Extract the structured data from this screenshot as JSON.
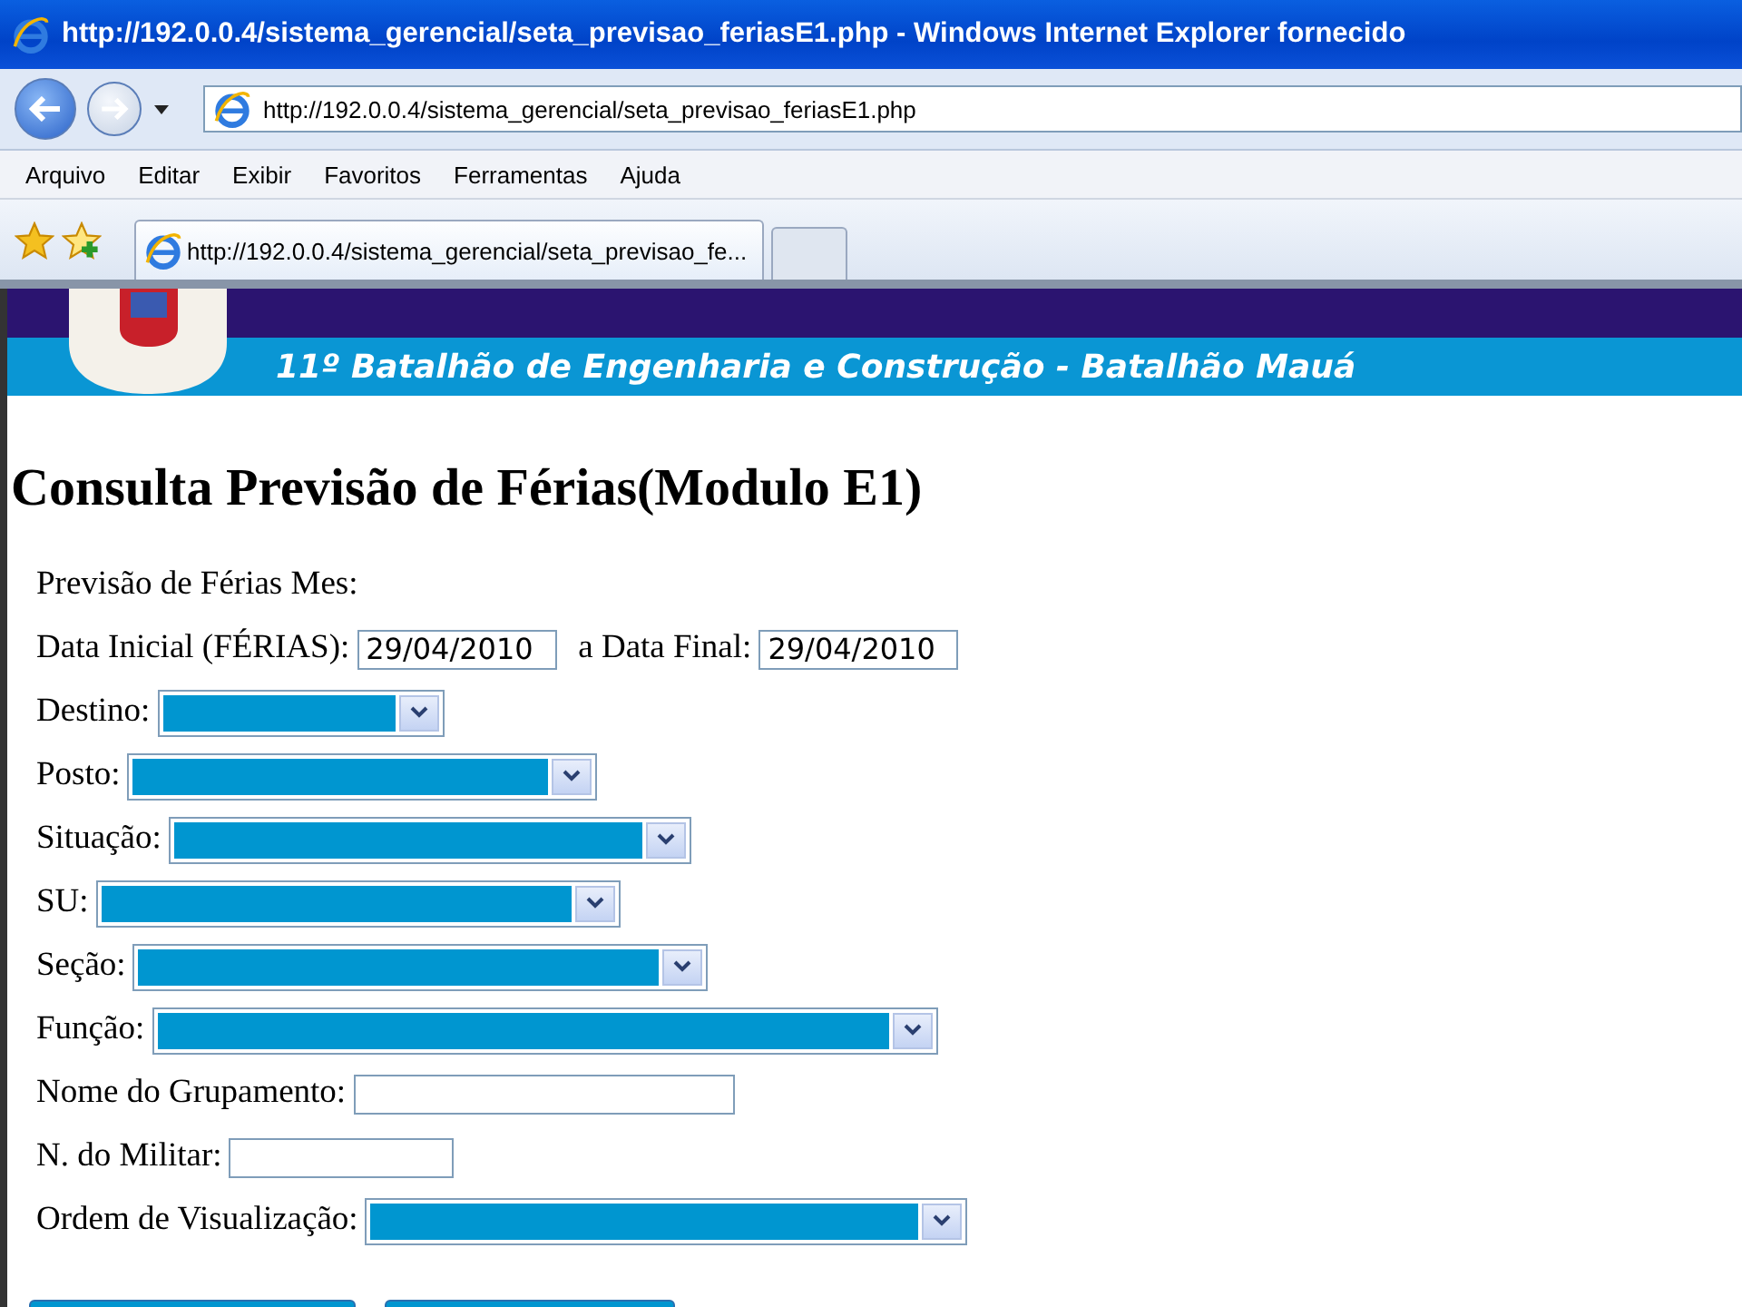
{
  "window": {
    "title": "http://192.0.0.4/sistema_gerencial/seta_previsao_feriasE1.php - Windows Internet Explorer fornecido"
  },
  "address_bar": {
    "url": "http://192.0.0.4/sistema_gerencial/seta_previsao_feriasE1.php"
  },
  "menu_bar": [
    "Arquivo",
    "Editar",
    "Exibir",
    "Favoritos",
    "Ferramentas",
    "Ajuda"
  ],
  "tabs": [
    {
      "label": "http://192.0.0.4/sistema_gerencial/seta_previsao_fe...",
      "selected": true
    }
  ],
  "banner": {
    "title": "11º Batalhão de Engenharia e Construção - Batalhão Mauá"
  },
  "heading": "Consulta Previsão de Férias(Modulo E1)",
  "form": [
    {
      "items": [
        {
          "kind": "label",
          "text": "Previsão de Férias Mes:"
        }
      ]
    },
    {
      "items": [
        {
          "kind": "label",
          "text": "Data Inicial (FÉRIAS):"
        },
        {
          "kind": "input",
          "value": "29/04/2010"
        },
        {
          "kind": "label",
          "text": "a Data Final:"
        },
        {
          "kind": "input",
          "value": "29/04/2010"
        }
      ]
    },
    {
      "items": [
        {
          "kind": "label",
          "text": "Destino:"
        },
        {
          "kind": "select"
        }
      ]
    },
    {
      "items": [
        {
          "kind": "label",
          "text": "Posto:"
        },
        {
          "kind": "select"
        }
      ]
    },
    {
      "items": [
        {
          "kind": "label",
          "text": "Situação:"
        },
        {
          "kind": "select"
        }
      ]
    },
    {
      "items": [
        {
          "kind": "label",
          "text": "SU:"
        },
        {
          "kind": "select"
        }
      ]
    },
    {
      "items": [
        {
          "kind": "label",
          "text": "Seção:"
        },
        {
          "kind": "select"
        }
      ]
    },
    {
      "items": [
        {
          "kind": "label",
          "text": "Função:"
        },
        {
          "kind": "select"
        }
      ]
    },
    {
      "items": [
        {
          "kind": "label",
          "text": "Nome do Grupamento:"
        },
        {
          "kind": "input"
        }
      ]
    },
    {
      "items": [
        {
          "kind": "label",
          "text": "N. do Militar:"
        },
        {
          "kind": "input"
        }
      ]
    },
    {
      "items": [
        {
          "kind": "label",
          "text": "Ordem de Visualização:"
        },
        {
          "kind": "select"
        }
      ]
    }
  ],
  "buttons": [
    {
      "kind": "button"
    },
    {
      "kind": "button"
    }
  ]
}
